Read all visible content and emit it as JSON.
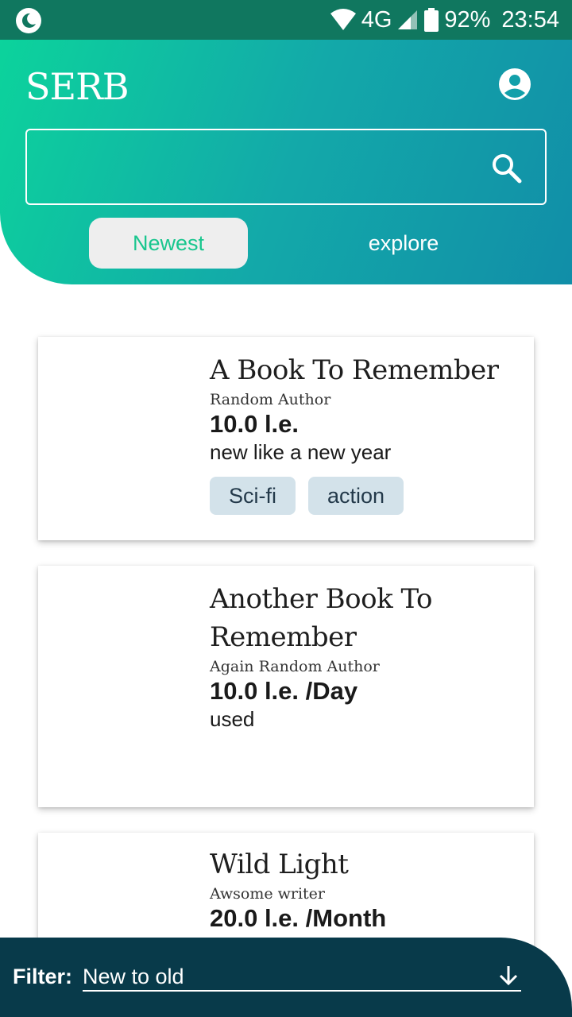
{
  "status_bar": {
    "network": "4G",
    "battery": "92%",
    "time": "23:54",
    "icons": [
      "moon-icon",
      "wifi-icon",
      "signal-icon",
      "battery-icon"
    ]
  },
  "header": {
    "app_title": "SERB",
    "search": {
      "value": "",
      "placeholder": ""
    },
    "tabs": [
      {
        "label": "Newest",
        "selected": true
      },
      {
        "label": "explore",
        "selected": false
      }
    ]
  },
  "books": [
    {
      "title": "A Book To Remember",
      "author": "Random Author",
      "price": "10.0 l.e.",
      "condition": "new like a new year",
      "tags": [
        "Sci-fi",
        "action"
      ]
    },
    {
      "title": "Another Book To Remember",
      "author": "Again Random Author",
      "price": "10.0 l.e. /Day",
      "condition": "used",
      "tags": []
    },
    {
      "title": "Wild Light",
      "author": "Awsome writer",
      "price": "20.0 l.e. /Month",
      "condition": "",
      "tags": []
    }
  ],
  "filter": {
    "label": "Filter:",
    "value": "New to old"
  },
  "colors": {
    "header_gradient_start": "#0cd39c",
    "header_gradient_end": "#118ea8",
    "tab_active_text": "#19c68e",
    "tag_bg": "#d3e2ea",
    "filter_bar_bg": "#083a4a"
  }
}
